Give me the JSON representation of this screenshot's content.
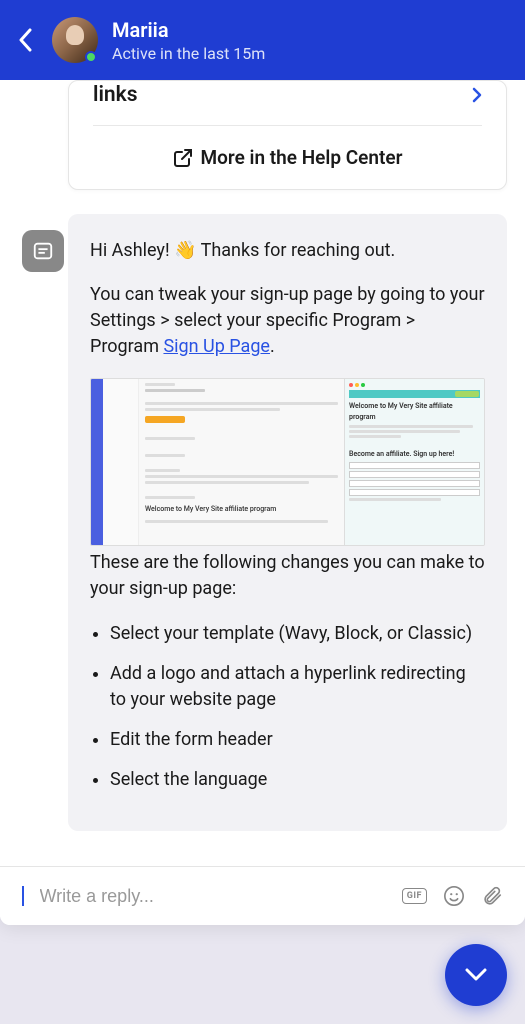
{
  "header": {
    "agent_name": "Mariia",
    "status": "Active in the last 15m"
  },
  "card": {
    "top_link_text": "links",
    "help_center_text": "More in the Help Center"
  },
  "message": {
    "greeting_prefix": "Hi Ashley! ",
    "greeting_emoji": "👋",
    "greeting_suffix": " Thanks for reaching out.",
    "p2_before": "You can tweak your sign-up page by going to your Settings > select your specific Program > Program ",
    "p2_link": "Sign Up Page",
    "p2_after": ".",
    "screenshot": {
      "panel_title_left": "Welcome to My Very Site affiliate program",
      "panel_title_right": "Welcome to My Very Site affiliate program",
      "form_title": "Become an affiliate. Sign up here!"
    },
    "changes_intro": "These are the following changes you can make to your sign-up page:",
    "bullets": [
      "Select your template (Wavy, Block, or Classic)",
      "Add a logo and attach a hyperlink redirecting to your website page",
      "Edit the form header",
      "Select the language"
    ]
  },
  "reply": {
    "placeholder": "Write a reply...",
    "gif_label": "GIF"
  }
}
